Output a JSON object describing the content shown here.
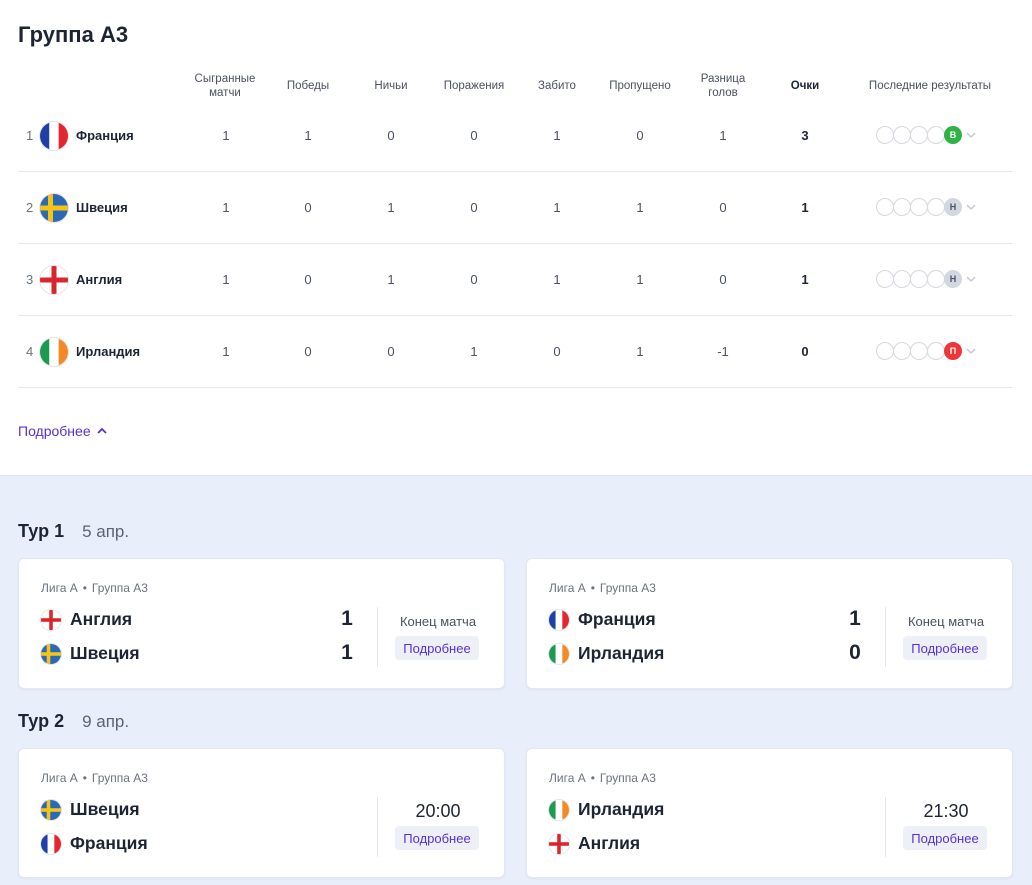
{
  "group": {
    "title": "Группа A3",
    "headers": {
      "played": "Сыгранные матчи",
      "wins": "Победы",
      "draws": "Ничьи",
      "losses": "Поражения",
      "scored": "Забито",
      "conceded": "Пропущено",
      "diff": "Разница голов",
      "points": "Очки",
      "form": "Последние результаты"
    },
    "rows": [
      {
        "pos": "1",
        "team": "Франция",
        "flag": "france",
        "played": "1",
        "wins": "1",
        "draws": "0",
        "losses": "0",
        "scored": "1",
        "conceded": "0",
        "diff": "1",
        "points": "3",
        "result": "В",
        "result_type": "win"
      },
      {
        "pos": "2",
        "team": "Швеция",
        "flag": "sweden",
        "played": "1",
        "wins": "0",
        "draws": "1",
        "losses": "0",
        "scored": "1",
        "conceded": "1",
        "diff": "0",
        "points": "1",
        "result": "Н",
        "result_type": "draw"
      },
      {
        "pos": "3",
        "team": "Англия",
        "flag": "england",
        "played": "1",
        "wins": "0",
        "draws": "1",
        "losses": "0",
        "scored": "1",
        "conceded": "1",
        "diff": "0",
        "points": "1",
        "result": "Н",
        "result_type": "draw"
      },
      {
        "pos": "4",
        "team": "Ирландия",
        "flag": "ireland",
        "played": "1",
        "wins": "0",
        "draws": "0",
        "losses": "1",
        "scored": "0",
        "conceded": "1",
        "diff": "-1",
        "points": "0",
        "result": "П",
        "result_type": "loss"
      }
    ],
    "more_link": "Подробнее"
  },
  "colors": {
    "win": "#2fb344",
    "draw": "#d3d7e2",
    "loss": "#f0353a",
    "accent": "#5a2fd6",
    "section_bg": "#e9eefb"
  },
  "tours": [
    {
      "name": "Тур 1",
      "date": "5 апр.",
      "matches": [
        {
          "league": "Лига А",
          "group": "Группа A3",
          "home": "Англия",
          "home_flag": "england",
          "away": "Швеция",
          "away_flag": "sweden",
          "home_score": "1",
          "away_score": "1",
          "status": "Конец матча",
          "button": "Подробнее"
        },
        {
          "league": "Лига А",
          "group": "Группа A3",
          "home": "Франция",
          "home_flag": "france",
          "away": "Ирландия",
          "away_flag": "ireland",
          "home_score": "1",
          "away_score": "0",
          "status": "Конец матча",
          "button": "Подробнее"
        }
      ]
    },
    {
      "name": "Тур 2",
      "date": "9 апр.",
      "matches": [
        {
          "league": "Лига А",
          "group": "Группа A3",
          "home": "Швеция",
          "home_flag": "sweden",
          "away": "Франция",
          "away_flag": "france",
          "time": "20:00",
          "button": "Подробнее"
        },
        {
          "league": "Лига А",
          "group": "Группа A3",
          "home": "Ирландия",
          "home_flag": "ireland",
          "away": "Англия",
          "away_flag": "england",
          "time": "21:30",
          "button": "Подробнее"
        }
      ]
    }
  ]
}
